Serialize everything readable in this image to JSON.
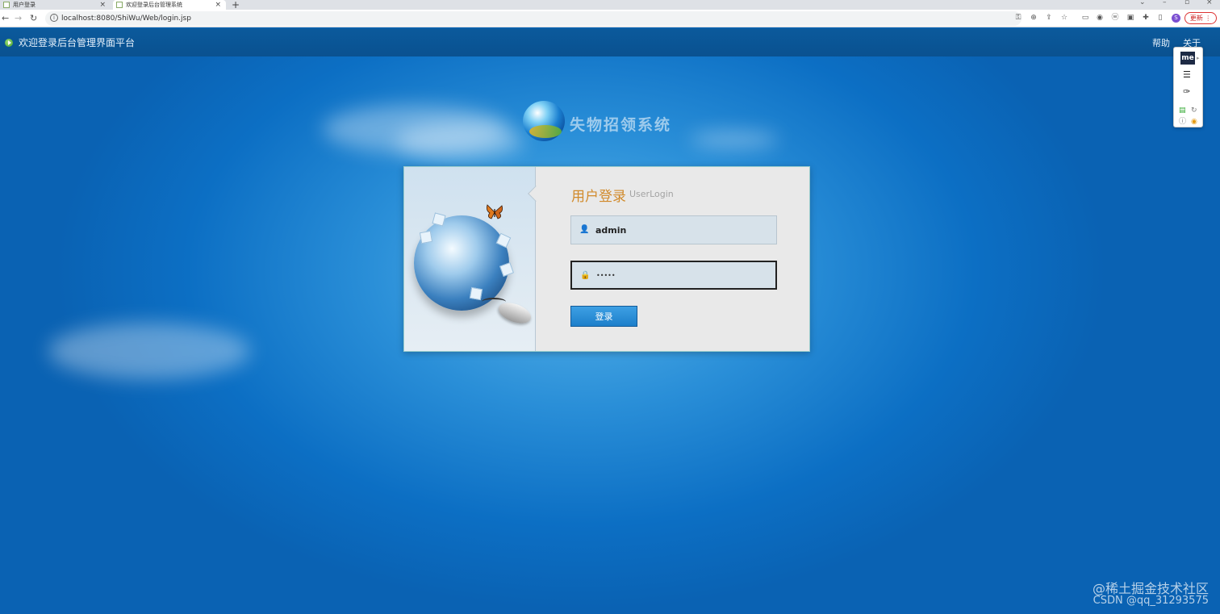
{
  "browser": {
    "tabs": [
      {
        "label": "用户登录"
      },
      {
        "label": "欢迎登录后台管理系统"
      }
    ],
    "url": "localhost:8080/ShiWu/Web/login.jsp",
    "update_label": "更新",
    "profile_initial": "S"
  },
  "header": {
    "title": "欢迎登录后台管理界面平台",
    "links": [
      {
        "label": "帮助"
      },
      {
        "label": "关于"
      }
    ]
  },
  "logo": {
    "text": "失物招领系统"
  },
  "login": {
    "heading": "用户登录",
    "heading_en": "UserLogin",
    "username_value": "admin",
    "password_value": "•••••",
    "submit_label": "登录"
  },
  "extension": {
    "badge": "me"
  },
  "watermark": {
    "line1": "@稀土掘金技术社区",
    "line2": "CSDN @qq_31293575"
  },
  "colors": {
    "heading": "#d18a2b",
    "button": "#1d7fca",
    "header_bar": "#0a5190"
  }
}
